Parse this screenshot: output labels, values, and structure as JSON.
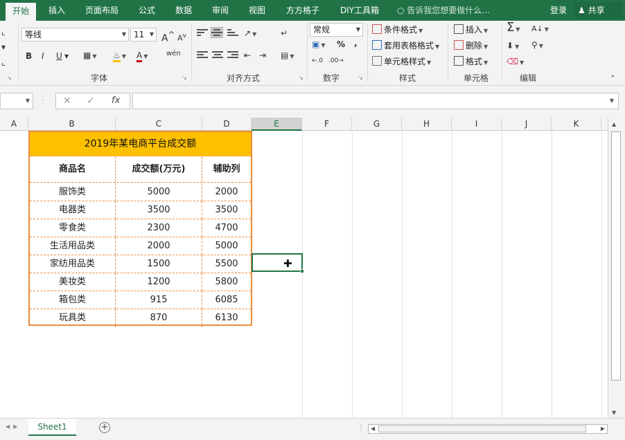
{
  "ribbon_tabs": [
    "开始",
    "插入",
    "页面布局",
    "公式",
    "数据",
    "审阅",
    "视图",
    "方方格子",
    "DIY工具箱"
  ],
  "tell_me": "告诉我您想要做什么...",
  "login": "登录",
  "share": "共享",
  "font": {
    "name": "等线",
    "size": "11",
    "group_label": "字体",
    "bold": "B",
    "italic": "I",
    "underline": "U",
    "grow": "A",
    "shrink": "A",
    "wen": "wén"
  },
  "alignment": {
    "group_label": "对齐方式"
  },
  "number": {
    "format": "常规",
    "group_label": "数字",
    "percent": "%",
    "comma": ","
  },
  "styles": {
    "conditional": "条件格式",
    "table": "套用表格格式",
    "cell": "单元格样式",
    "group_label": "样式"
  },
  "cells": {
    "insert": "插入",
    "delete": "删除",
    "format": "格式",
    "group_label": "单元格"
  },
  "editing": {
    "group_label": "编辑"
  },
  "formula_bar": {
    "fx": "fx",
    "value": ""
  },
  "columns": [
    "A",
    "B",
    "C",
    "D",
    "E",
    "F",
    "G",
    "H",
    "I",
    "J",
    "K"
  ],
  "selected_column": "E",
  "table": {
    "title": "2019年某电商平台成交额",
    "headers": [
      "商品名",
      "成交额(万元)",
      "辅助列"
    ],
    "rows": [
      [
        "服饰类",
        "5000",
        "2000"
      ],
      [
        "电器类",
        "3500",
        "3500"
      ],
      [
        "零食类",
        "2300",
        "4700"
      ],
      [
        "生活用品类",
        "2000",
        "5000"
      ],
      [
        "家纺用品类",
        "1500",
        "5500"
      ],
      [
        "美妆类",
        "1200",
        "5800"
      ],
      [
        "箱包类",
        "915",
        "6085"
      ],
      [
        "玩具类",
        "870",
        "6130"
      ]
    ]
  },
  "sheet_tab": "Sheet1"
}
